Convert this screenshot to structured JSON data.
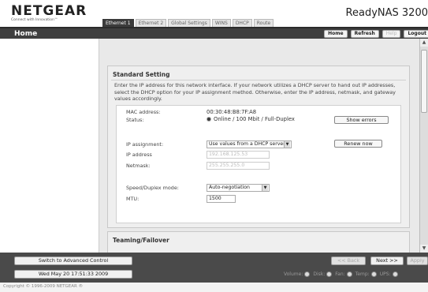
{
  "logo": {
    "word": "NETGEAR",
    "tagline": "Connect with Innovation™"
  },
  "product_name": "ReadyNAS 3200",
  "tabs": [
    {
      "label": "Ethernet 1",
      "active": true
    },
    {
      "label": "Ethernet 2",
      "active": false
    },
    {
      "label": "Global Settings",
      "active": false
    },
    {
      "label": "WINS",
      "active": false
    },
    {
      "label": "DHCP",
      "active": false
    },
    {
      "label": "Route",
      "active": false
    }
  ],
  "top_bar": {
    "title": "Home",
    "buttons": {
      "home": "Home",
      "refresh": "Refresh",
      "help": "Help",
      "logout": "Logout"
    }
  },
  "standard": {
    "title": "Standard Setting",
    "description": "Enter the IP address for this network interface. If your network utilizes a DHCP server to hand out IP addresses, select the DHCP option for your IP assignment method. Otherwise, enter the IP address, netmask, and gateway values accordingly.",
    "mac_label": "MAC address:",
    "mac_value": "00:30:48:B8:7F:A8",
    "status_label": "Status:",
    "status_value": "Online / 100 Mbit / Full-Duplex",
    "show_errors": "Show errors",
    "ip_assign_label": "IP assignment:",
    "ip_assign_value": "Use values from a DHCP server",
    "renew_now": "Renew now",
    "ip_label": "IP address",
    "ip_value": "192.168.125.53",
    "netmask_label": "Netmask:",
    "netmask_value": "255.255.255.0",
    "speed_label": "Speed/Duplex mode:",
    "speed_value": "Auto-negotiation",
    "mtu_label": "MTU:",
    "mtu_value": "1500"
  },
  "teaming": {
    "title": "Teaming/Failover"
  },
  "bottom": {
    "switch_advanced": "Switch to Advanced Control",
    "datetime": "Wed May 20 17:51:33 2009",
    "back": "<< Back",
    "next": "Next >>",
    "apply": "Apply",
    "status": {
      "volume": "Volume:",
      "disk": "Disk:",
      "fan": "Fan:",
      "temp": "Temp:",
      "ups": "UPS:"
    }
  },
  "copyright": "Copyright © 1996-2009 NETGEAR ®",
  "colors": {
    "header_bar": "#3f3f3f",
    "active_tab": "#3b3b3b",
    "bottom_bar": "#4a4a4a"
  }
}
